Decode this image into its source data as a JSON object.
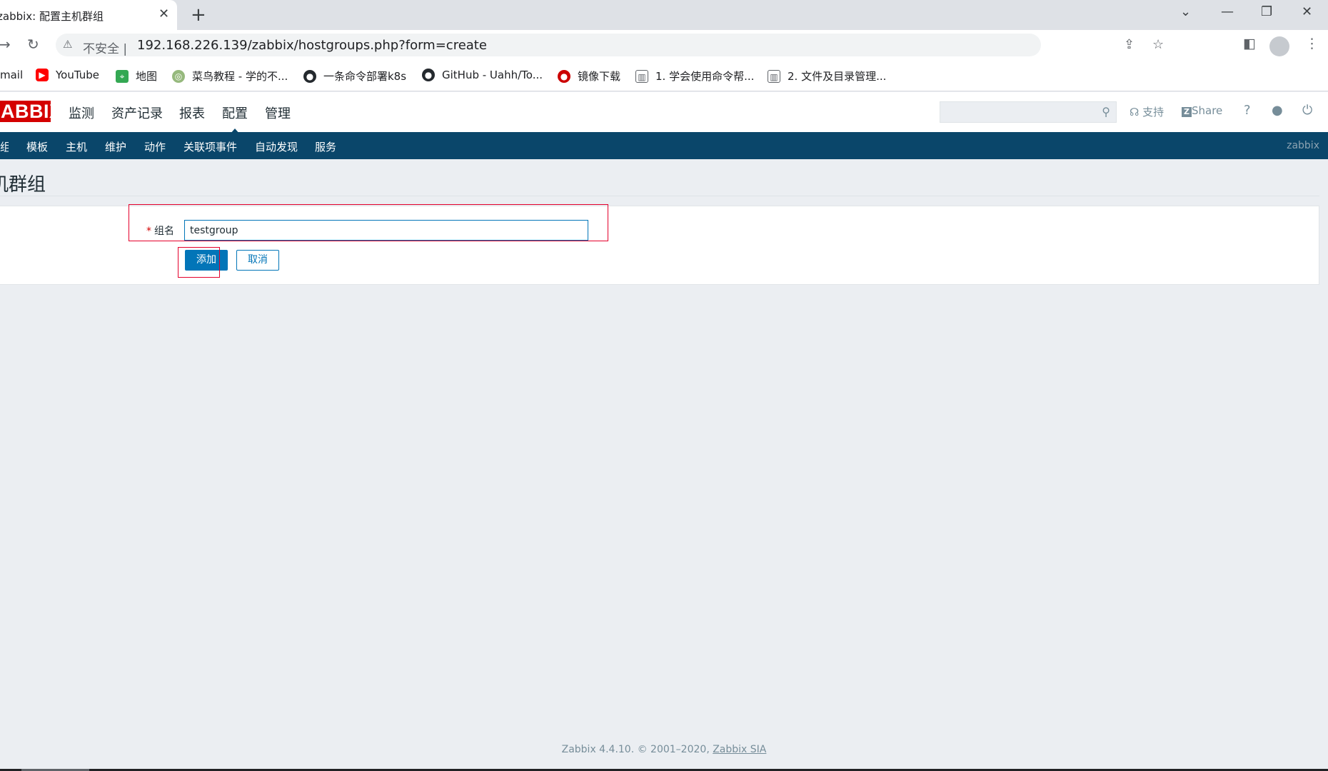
{
  "browser": {
    "tab_title": "zabbix: 配置主机群组",
    "tab_close": "✕",
    "new_tab": "+",
    "omnibox": {
      "warning": "⚠",
      "insecure_label": "不安全 |",
      "url": "192.168.226.139/zabbix/hostgroups.php?form=create"
    },
    "bookmarks": [
      {
        "label": "mail",
        "icon": "none"
      },
      {
        "label": "YouTube",
        "icon": "youtube-icon",
        "color": "#ff0000"
      },
      {
        "label": "地图",
        "icon": "maps-icon",
        "color": "#34a853"
      },
      {
        "label": "菜鸟教程 - 学的不...",
        "icon": "runoob-icon",
        "color": "#96b97d"
      },
      {
        "label": "一条命令部署k8s",
        "icon": "github-icon",
        "color": "#24292e"
      },
      {
        "label": "GitHub - Uahh/To...",
        "icon": "github-icon",
        "color": "#24292e"
      },
      {
        "label": "镜像下载",
        "icon": "redhat-icon",
        "color": "#cc0000"
      },
      {
        "label": "1. 学会使用命令帮...",
        "icon": "book-icon",
        "color": "#5f6368"
      },
      {
        "label": "2. 文件及目录管理...",
        "icon": "book-icon",
        "color": "#5f6368"
      }
    ]
  },
  "zabbix": {
    "logo_text": "ZABBIX",
    "main_menu": [
      "监测",
      "资产记录",
      "报表",
      "配置",
      "管理"
    ],
    "active_main": "配置",
    "header_links": {
      "support": "支持",
      "share": "Share",
      "help": "?"
    },
    "sub_menu": [
      "主机群组",
      "模板",
      "主机",
      "维护",
      "动作",
      "关联项事件",
      "自动发现",
      "服务"
    ],
    "active_sub": "主机群组",
    "username": "zabbix",
    "page_title": "主机群组",
    "form": {
      "required_mark": "*",
      "group_name_label": "组名",
      "group_name_value": "testgroup",
      "add_button": "添加",
      "cancel_button": "取消"
    },
    "footer": {
      "text": "Zabbix 4.4.10. © 2001–2020, ",
      "link": "Zabbix SIA"
    }
  },
  "colors": {
    "brand_red": "#d40000",
    "nav_blue": "#0a466a",
    "button_blue": "#0275b8",
    "highlight_red": "#e4002b"
  }
}
